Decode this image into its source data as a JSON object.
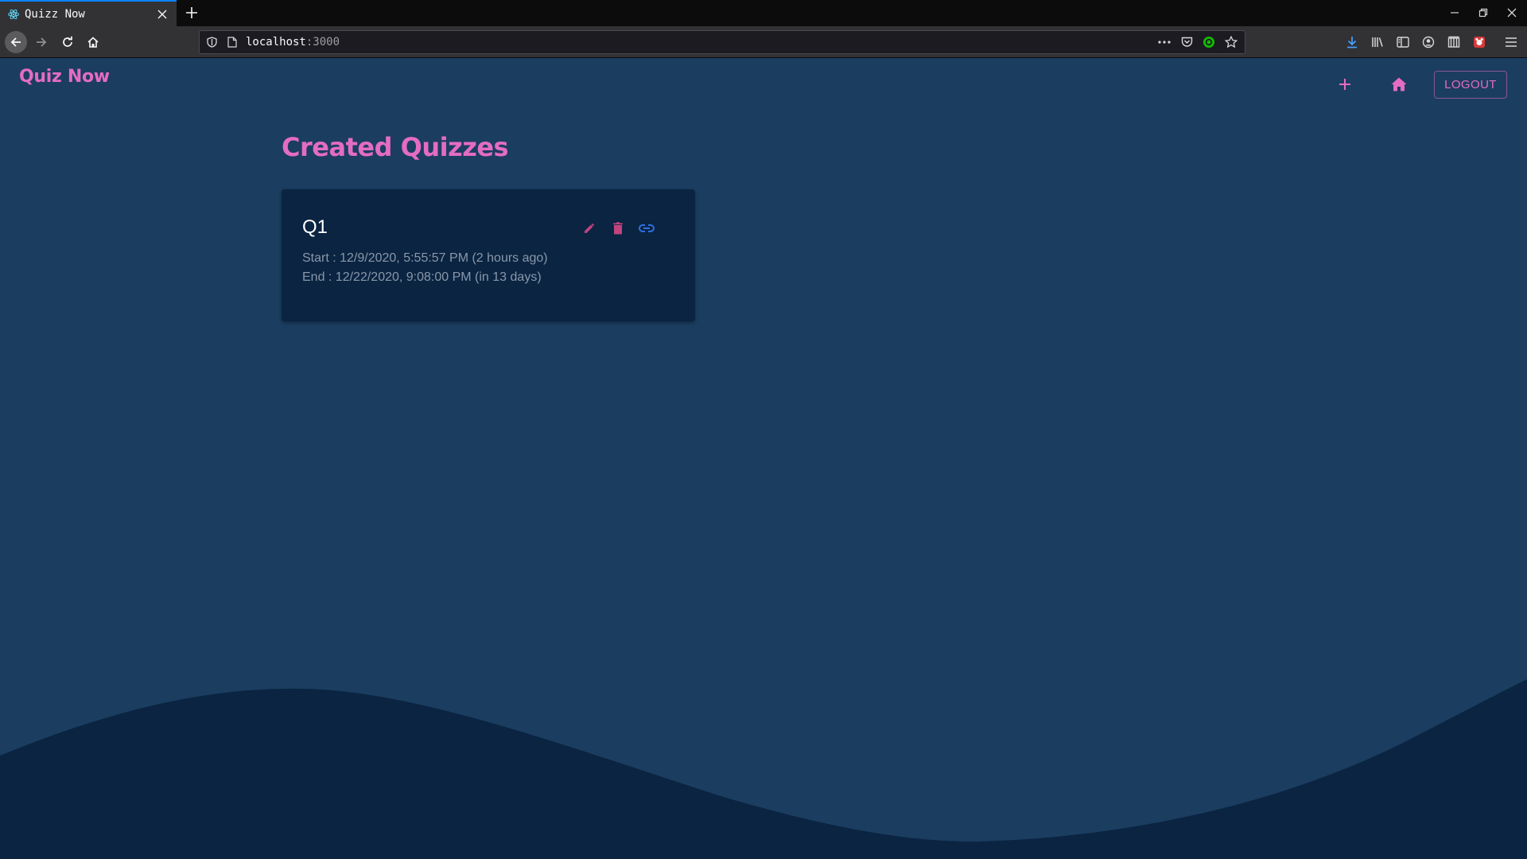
{
  "browser": {
    "tab_title": "Quizz Now",
    "url_host": "localhost",
    "url_port": ":3000"
  },
  "app": {
    "brand": "Quiz Now",
    "logout_label": "LOGOUT",
    "heading": "Created Quizzes",
    "colors": {
      "accent": "#e46cc2",
      "background": "#1b3d60",
      "card": "#0a2442",
      "wave": "#0a2442",
      "edit": "#c2447e",
      "link": "#2f6fe0"
    }
  },
  "quizzes": [
    {
      "title": "Q1",
      "start": "Start : 12/9/2020, 5:55:57 PM (2 hours ago)",
      "end": "End : 12/22/2020, 9:08:00 PM (in 13 days)"
    }
  ]
}
